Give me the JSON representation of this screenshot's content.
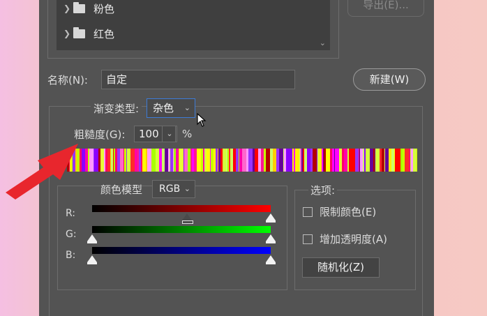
{
  "presets": {
    "items": [
      {
        "label": "粉色"
      },
      {
        "label": "红色"
      }
    ],
    "export_label": "导出(E)..."
  },
  "name": {
    "label": "名称(N):",
    "value": "自定",
    "new_button": "新建(W)"
  },
  "gradient": {
    "type_label": "渐变类型:",
    "type_value": "杂色",
    "roughness_label": "粗糙度(G):",
    "roughness_value": "100",
    "roughness_unit": "%"
  },
  "color_model": {
    "label": "颜色模型",
    "value": "RGB",
    "channels": [
      {
        "label": "R:",
        "gradient": [
          "#000000",
          "#ff0000"
        ],
        "thumbs": [
          0.53,
          1.0
        ]
      },
      {
        "label": "G:",
        "gradient": [
          "#000000",
          "#00ff00"
        ],
        "thumbs": [
          0.0,
          1.0
        ]
      },
      {
        "label": "B:",
        "gradient": [
          "#000000",
          "#0000ff"
        ],
        "thumbs": [
          0.0,
          1.0
        ]
      }
    ]
  },
  "options": {
    "label": "选项:",
    "restrict_colors": "限制颜色(E)",
    "add_transparency": "增加透明度(A)",
    "randomize": "随机化(Z)"
  },
  "noise_colors": [
    "#ff00ff",
    "#c8ff00",
    "#ffff00",
    "#8b00ff",
    "#ff0066",
    "#e6ff33",
    "#ff2a2a",
    "#ccff66",
    "#9933ff",
    "#ff00aa",
    "#ffee00",
    "#b30000",
    "#d4ff3b",
    "#ff66cc",
    "#660099",
    "#ffcc00",
    "#ff1493",
    "#aaff00",
    "#ff0000",
    "#ff99ff"
  ],
  "accent_color": "#3d7bd6",
  "annotation_color": "#e8262d"
}
